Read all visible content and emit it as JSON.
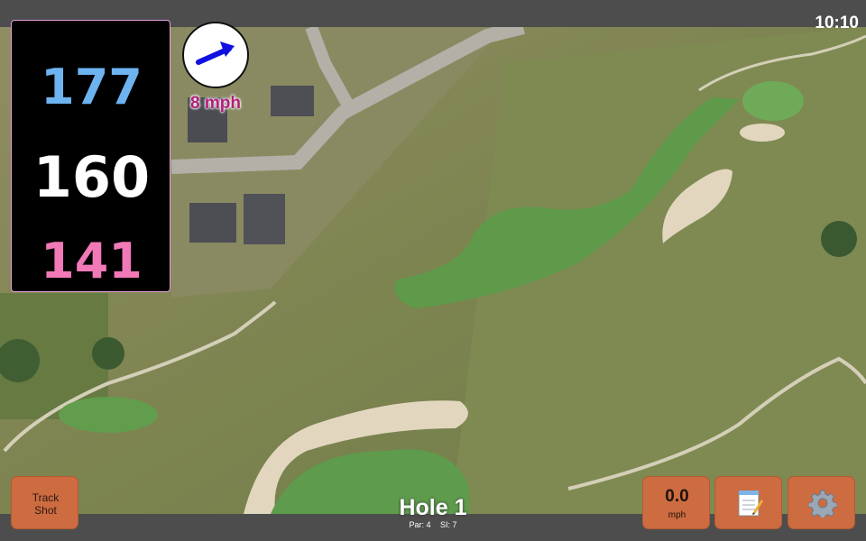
{
  "status": {
    "time": "10:10"
  },
  "distances": {
    "back": "177",
    "center": "160",
    "front": "141"
  },
  "wind": {
    "speed": "8 mph",
    "icon": "arrow-right-icon"
  },
  "controls": {
    "track_shot_label": "Track Shot",
    "speed_value": "0.0",
    "speed_unit": "mph",
    "notes_icon": "notepad-icon",
    "settings_icon": "gear-icon"
  },
  "hole": {
    "title": "Hole 1",
    "par": "Par: 4",
    "stroke_index": "SI: 7"
  },
  "colors": {
    "back_distance": "#6db3f0",
    "center_distance": "#ffffff",
    "front_distance": "#f279b8",
    "button": "#cd6b41",
    "panel_border": "#e59ee0"
  }
}
